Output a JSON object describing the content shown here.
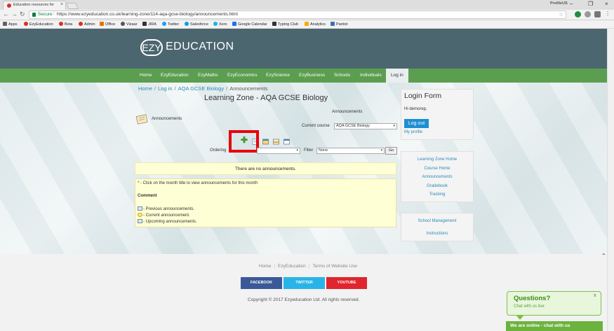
{
  "browser": {
    "tab_title": "Education resources for",
    "profile_name": "ProfileUS",
    "secure_label": "Secure",
    "url": "https://www.ezyeducation.co.uk/learning-zone/114-aqa-gcse-biology/announcements.html",
    "bookmarks": [
      "Apps",
      "EzyEducation",
      "Beta",
      "Admin",
      "Office",
      "Vizaar",
      "JIRA",
      "Twitter",
      "Salesforce",
      "Xero",
      "Google Calendar",
      "Typing Club",
      "Analytics",
      "Pardot"
    ]
  },
  "site": {
    "logo_mark": "EZY",
    "logo_text": "EDUCATION",
    "nav": [
      "Home",
      "EzyEducation",
      "EzyMaths",
      "EzyEconomics",
      "EzyScience",
      "EzyBusiness",
      "Schools",
      "Individuals",
      "Log in"
    ]
  },
  "breadcrumb": [
    "Home",
    "Log in",
    "AQA GCSE Biology",
    "Announcements"
  ],
  "page_title": "Learning Zone - AQA GCSE Biology",
  "announcements": {
    "label": "Announcements",
    "header_right": "Announcements",
    "current_course_label": "Current course",
    "current_course_value": "AQA GCSE Biology",
    "ordering_label": "Ordering",
    "filter_label": "Filter",
    "filter_value": "None",
    "go_label": "Go",
    "empty_message": "There are no announcements.",
    "info_note": "* - Click on the month title to view announcements for this month",
    "comment_heading": "Comment",
    "legend": [
      "- Previous announcements.",
      "- Current announcement.",
      "- Upcoming announcements."
    ]
  },
  "login": {
    "title": "Login Form",
    "greeting": "Hi demorep,",
    "logout_label": "Log out",
    "profile_link": "My profile"
  },
  "side_links": [
    "Learning Zone Home",
    "Course Home",
    "Announcements",
    "Gradebook",
    "Tracking"
  ],
  "side_links2": [
    "School Management",
    "Instructions"
  ],
  "footer": {
    "links": [
      "Home",
      "EzyEducation",
      "Terms of Website Use"
    ],
    "social": [
      "FACEBOOK",
      "TWITTER",
      "YOUTUBE"
    ],
    "copyright": "Copyright © 2017 Ezyeducation Ltd. All rights reserved."
  },
  "chat": {
    "title": "Questions?",
    "subtitle": "Chat with us live",
    "bar": "We are online - chat with us",
    "close": "x"
  },
  "colors": {
    "header": "#4c6670",
    "nav_green": "#5b9e4f",
    "highlight_red": "#e8000c",
    "notice_yellow": "#ffffd5",
    "logout_blue": "#1d8fd3",
    "facebook": "#3b5998",
    "twitter": "#29b4e8",
    "youtube": "#e0252e"
  }
}
